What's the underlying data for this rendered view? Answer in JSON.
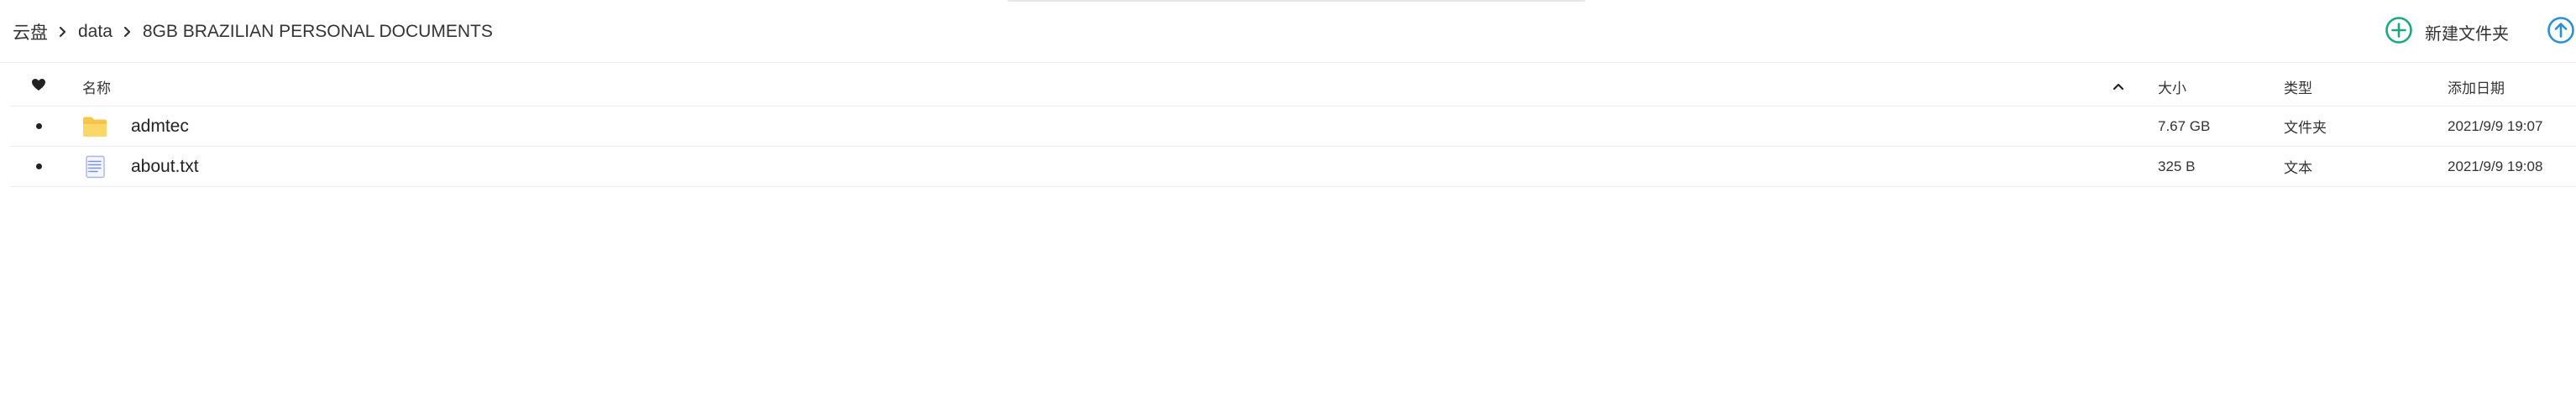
{
  "breadcrumb": {
    "items": [
      "云盘",
      "data",
      "8GB BRAZILIAN PERSONAL DOCUMENTS"
    ]
  },
  "actions": {
    "new_folder_label": "新建文件夹"
  },
  "colors": {
    "accent_green": "#1aaa78",
    "accent_blue": "#2b8fd6",
    "folder_yellow": "#f7c74a",
    "file_blue": "#7b8ed8"
  },
  "table": {
    "headers": {
      "name": "名称",
      "size": "大小",
      "type": "类型",
      "date": "添加日期"
    },
    "rows": [
      {
        "icon": "folder-icon",
        "name": "admtec",
        "size": "7.67 GB",
        "type": "文件夹",
        "date": "2021/9/9 19:07"
      },
      {
        "icon": "text-file-icon",
        "name": "about.txt",
        "size": "325 B",
        "type": "文本",
        "date": "2021/9/9 19:08"
      }
    ]
  }
}
